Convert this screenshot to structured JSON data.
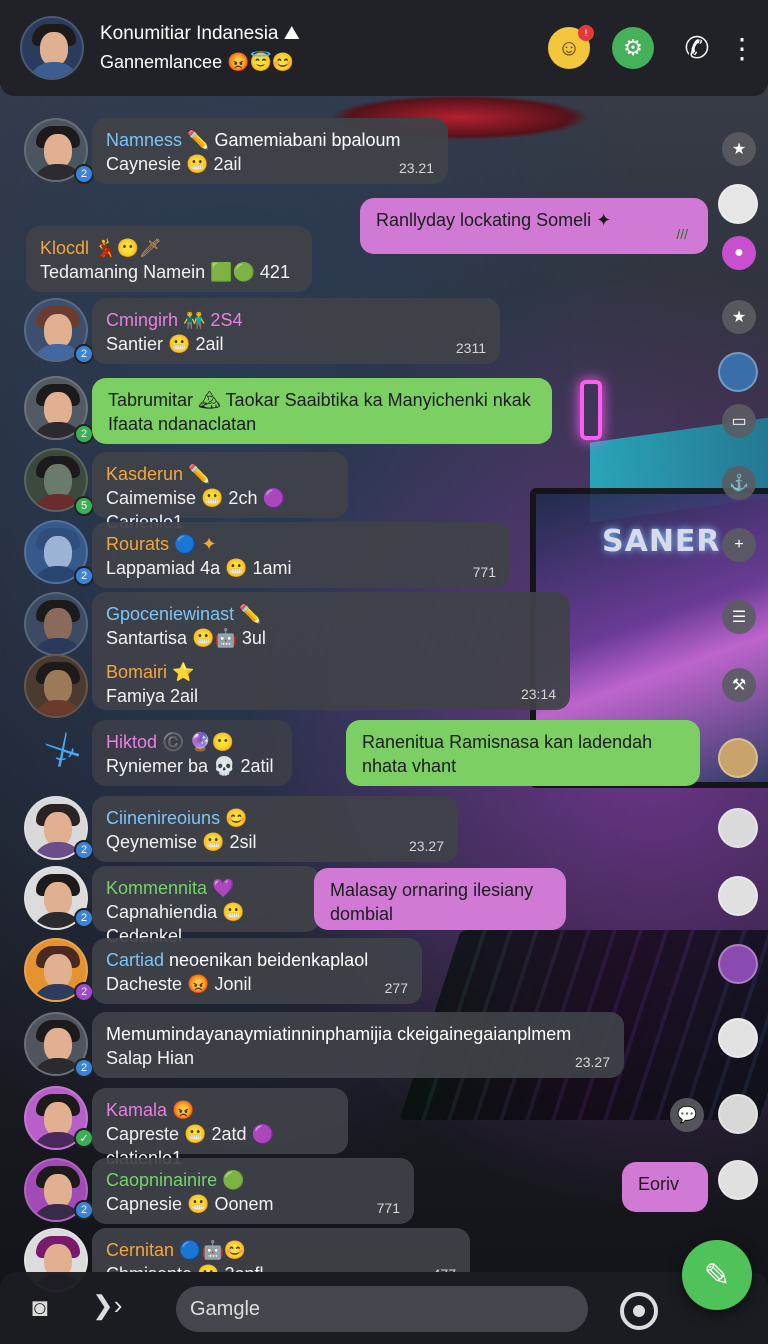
{
  "header": {
    "title": "Konumitiar Indanesia ⛰",
    "subtitle": "Gannemlancee 😡😇😊",
    "icons": [
      "smile-icon",
      "gear-icon",
      "phone-icon",
      "kebab-menu-icon"
    ],
    "notif_badge": "!"
  },
  "messages": [
    {
      "name": "Namness ✏️",
      "extra": " Gamemiabani bpaloum",
      "text": "Caynesie 😬 2ail",
      "time": "23.21"
    },
    {
      "name": "Klocdl 💃😶🗡",
      "text": "Tedamaning Namein 🟩🟢 421",
      "time": ""
    },
    {
      "name": "Cmingirh 👬 2S4",
      "text": "Santier 😬 2ail",
      "time": "2311"
    },
    {
      "name": "Kasderun ✏️",
      "text": "Caimemise 😬 2ch 🟣 Carienlo1",
      "time": ""
    },
    {
      "name": "Rourats 🔵 ✦",
      "text": "Lappamiad 4a 😬 1ami",
      "time": "771"
    },
    {
      "name": "Gpoceniewinast ✏️",
      "text": "Santartisa 😬🤖 3ul",
      "time": ""
    },
    {
      "name": "Bomairi ⭐",
      "text": "Famiya 2ail",
      "time": "23:14"
    },
    {
      "name": "Hiktod ©️ 🔮😶",
      "text": "Ryniemer ba 💀 2atil",
      "time": ""
    },
    {
      "name": "Ciinenireoiuns 😊",
      "text": "Qeynemise 😬 2sil",
      "time": "23.27"
    },
    {
      "name": "Kommennita 💜",
      "text": "Capnahiendia 😬 Cedenkel",
      "time": ""
    },
    {
      "name": "Cartiad",
      "extra": " neoenikan beidenkaplaol",
      "text": "Dacheste 😡 Jonil",
      "time": "277"
    },
    {
      "name": "",
      "extra": "Memumindayanaymiatinninphamijia ckeigainegaianplmem",
      "text": "Salap Hian",
      "time": "23.27"
    },
    {
      "name": "Kamala 😡",
      "text": "Capreste 😬 2atd 🟣 clatienlo1",
      "time": ""
    },
    {
      "name": "Caopninainire 🟢",
      "text": "Capnesie 😬 Oonem",
      "time": "771"
    },
    {
      "name": "Cernitan 🔵🤖😊",
      "text": "Chmisente 😬 2onfl",
      "time": "477"
    }
  ],
  "own_messages": [
    {
      "text": "Ranllyday lockating Someli ✦",
      "ticks": "///"
    },
    {
      "text": "Tabrumitar 🏔 Taokar Saaibtika ka Manyichenki nkak Ifaata ndanaclatan",
      "ticks": ""
    },
    {
      "text": "Ranenitua Ramisnasa kan ladendah nhata vhant",
      "ticks": ""
    },
    {
      "text": "Malasay ornaring ilesiany dombial",
      "ticks": ""
    },
    {
      "text": "Eoriv",
      "ticks": ""
    }
  ],
  "bottom": {
    "input_placeholder": "Gamgle",
    "icons": [
      "camera-icon",
      "chevron-right-icon",
      "target-icon",
      "edit-fab-icon"
    ]
  },
  "scene": {
    "monitor_title": "SANER"
  },
  "colors": {
    "pink_bubble": "#d07ad6",
    "green_bubble": "#7ccf62",
    "fab": "#4fc25a",
    "gear": "#45b15a"
  }
}
